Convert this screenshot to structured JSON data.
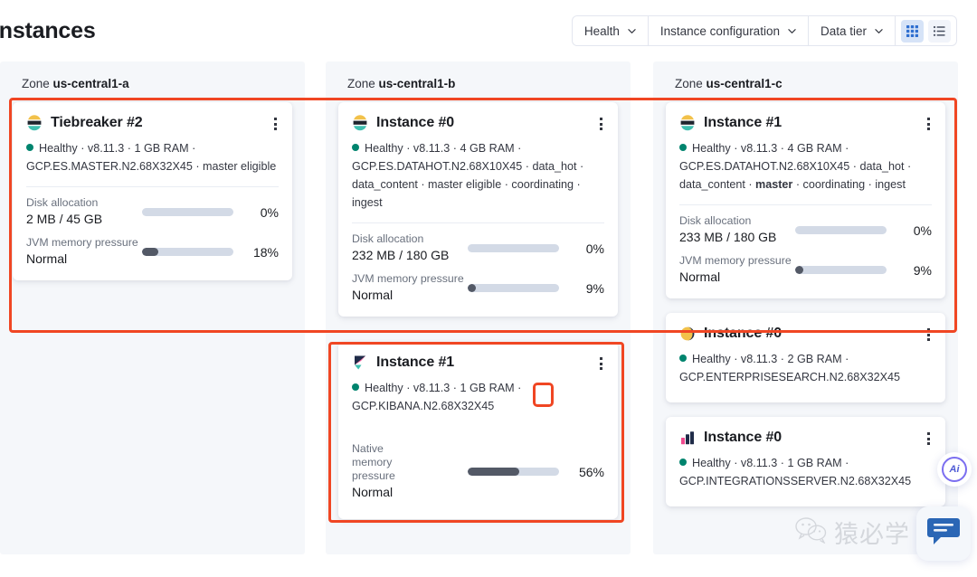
{
  "header": {
    "title": "Instances",
    "toolbar": {
      "filters": [
        {
          "label": "Health",
          "icon": "chevron-down-icon"
        },
        {
          "label": "Instance configuration",
          "icon": "chevron-down-icon"
        },
        {
          "label": "Data tier",
          "icon": "chevron-down-icon"
        }
      ],
      "views": [
        {
          "name": "grid-view-toggle",
          "icon": "grid-icon",
          "active": true
        },
        {
          "name": "list-view-toggle",
          "icon": "list-icon",
          "active": false
        }
      ]
    }
  },
  "zones": [
    {
      "label_prefix": "Zone",
      "name": "us-central1-a",
      "cards": [
        {
          "icon": "elasticsearch-icon",
          "title": "Tiebreaker #2",
          "kebab": "kebab-menu-icon",
          "health": "Healthy",
          "meta_plain": " · v8.11.3 · 1 GB RAM · GCP.ES.MASTER.N2.68X32X45 · master eligible",
          "bold_role": "",
          "metrics": [
            {
              "name": "Disk allocation",
              "value": "2 MB / 45 GB",
              "pct_label": "0%",
              "pct": 0
            },
            {
              "name": "JVM memory pressure",
              "value": "Normal",
              "pct_label": "18%",
              "pct": 18
            }
          ]
        }
      ]
    },
    {
      "label_prefix": "Zone",
      "name": "us-central1-b",
      "cards": [
        {
          "icon": "elasticsearch-icon",
          "title": "Instance #0",
          "kebab": "kebab-menu-icon",
          "health": "Healthy",
          "meta_plain": " · v8.11.3 · 4 GB RAM · GCP.ES.DATAHOT.N2.68X10X45 · data_hot · data_content · master eligible · coordinating · ingest",
          "bold_role": "",
          "metrics": [
            {
              "name": "Disk allocation",
              "value": "232 MB / 180 GB",
              "pct_label": "0%",
              "pct": 0
            },
            {
              "name": "JVM memory pressure",
              "value": "Normal",
              "pct_label": "9%",
              "pct": 9
            }
          ]
        },
        {
          "icon": "kibana-icon",
          "title": "Instance #1",
          "kebab": "kebab-menu-icon",
          "health": "Healthy",
          "meta_plain": " · v8.11.3 · 1 GB RAM · GCP.KIBANA.N2.68X32X45",
          "bold_role": "",
          "metrics": [
            {
              "name": "Native memory pressure",
              "value": "Normal",
              "pct_label": "56%",
              "pct": 56
            }
          ]
        }
      ]
    },
    {
      "label_prefix": "Zone",
      "name": "us-central1-c",
      "cards": [
        {
          "icon": "elasticsearch-icon",
          "title": "Instance #1",
          "kebab": "kebab-menu-icon",
          "health": "Healthy",
          "meta_plain": " · v8.11.3 · 4 GB RAM · GCP.ES.DATAHOT.N2.68X10X45 · data_hot · data_content · ",
          "bold_role": "master",
          "meta_tail": " · coordinating · ingest",
          "metrics": [
            {
              "name": "Disk allocation",
              "value": "233 MB / 180 GB",
              "pct_label": "0%",
              "pct": 0
            },
            {
              "name": "JVM memory pressure",
              "value": "Normal",
              "pct_label": "9%",
              "pct": 9
            }
          ]
        },
        {
          "icon": "enterprise-search-icon",
          "title": "Instance #0",
          "kebab": "kebab-menu-icon",
          "health": "Healthy",
          "meta_plain": " · v8.11.3 · 2 GB RAM · GCP.ENTERPRISESEARCH.N2.68X32X45",
          "bold_role": "",
          "metrics": []
        },
        {
          "icon": "integrations-server-icon",
          "title": "Instance #0",
          "kebab": "kebab-menu-icon",
          "health": "Healthy",
          "meta_plain": " · v8.11.3 · 1 GB RAM · GCP.INTEGRATIONSSERVER.N2.68X32X45",
          "bold_role": "",
          "metrics": []
        }
      ]
    }
  ],
  "annotations": [
    {
      "name": "annotation-box-top-row",
      "color": "#f04623"
    },
    {
      "name": "annotation-box-kibana-card",
      "color": "#f04623"
    },
    {
      "name": "annotation-box-small-highlight",
      "color": "#f04623"
    }
  ],
  "widgets": {
    "ai_badge_label": "Ai",
    "chat_icon": "chat-bubble-icon",
    "watermark_text": "猿必学",
    "watermark_icon": "wechat-icon"
  },
  "colors": {
    "accent_red": "#f04623",
    "health_green": "#00846e",
    "bar_fill": "#535966",
    "bar_track": "#d3dae6",
    "column_bg": "#f5f7fa"
  }
}
